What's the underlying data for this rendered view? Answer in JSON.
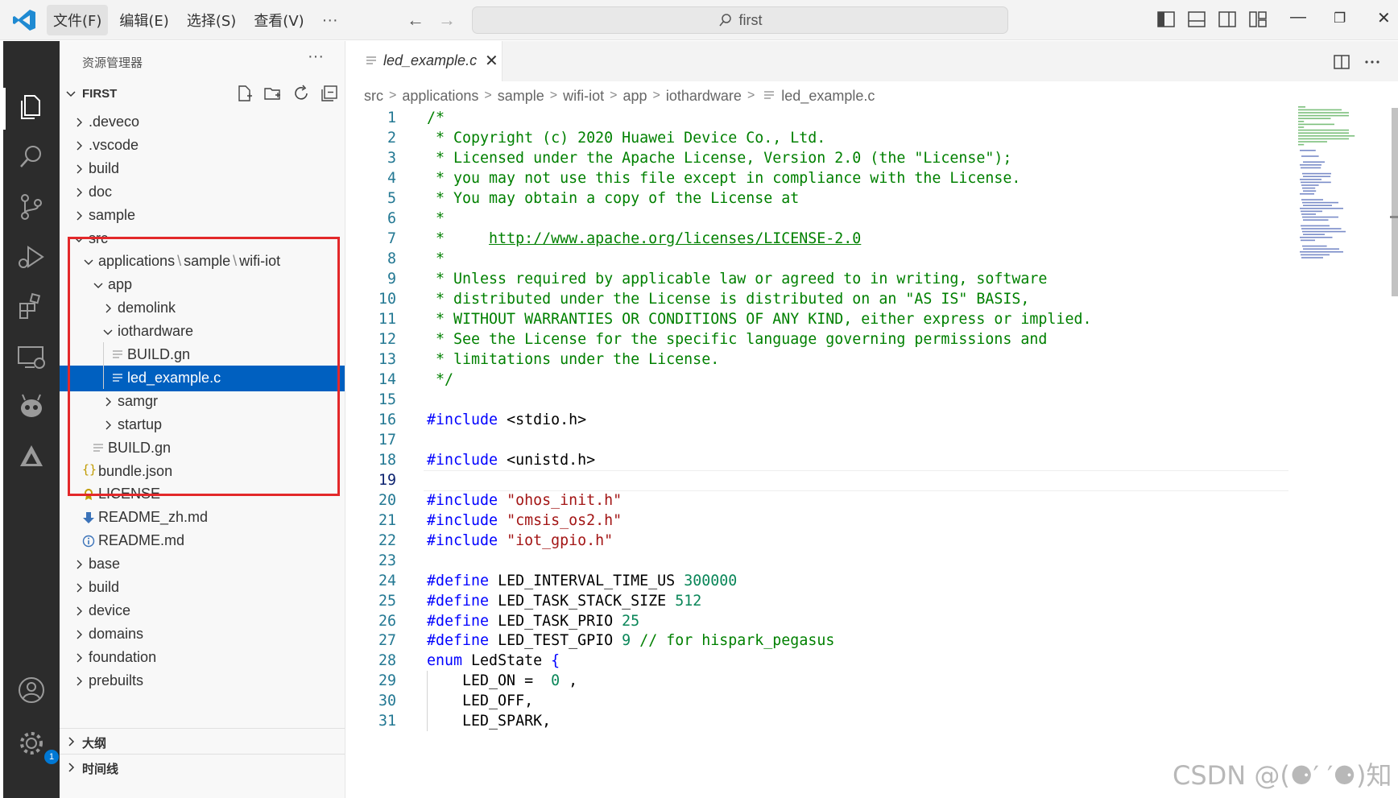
{
  "menu": {
    "items": [
      "文件(F)",
      "编辑(E)",
      "选择(S)",
      "查看(V)"
    ],
    "more": "···"
  },
  "command_center": {
    "text": "first"
  },
  "sidebar": {
    "title": "资源管理器",
    "more": "···",
    "section": "FIRST",
    "tree": [
      {
        "label": ".deveco",
        "kind": "folder"
      },
      {
        "label": ".vscode",
        "kind": "folder"
      },
      {
        "label": "build",
        "kind": "folder"
      },
      {
        "label": "doc",
        "kind": "folder"
      },
      {
        "label": "sample",
        "kind": "folder"
      },
      {
        "label": "src",
        "kind": "folder-open"
      },
      {
        "label_parts": [
          "applications",
          "sample",
          "wifi-iot"
        ],
        "kind": "folder-open"
      },
      {
        "label": "app",
        "kind": "folder-open"
      },
      {
        "label": "demolink",
        "kind": "folder"
      },
      {
        "label": "iothardware",
        "kind": "folder-open"
      },
      {
        "label": "BUILD.gn",
        "kind": "file"
      },
      {
        "label": "led_example.c",
        "kind": "file",
        "selected": true
      },
      {
        "label": "samgr",
        "kind": "folder"
      },
      {
        "label": "startup",
        "kind": "folder"
      },
      {
        "label": "BUILD.gn",
        "kind": "file"
      },
      {
        "label": "bundle.json",
        "kind": "json"
      },
      {
        "label": "LICENSE",
        "kind": "license"
      },
      {
        "label": "README_zh.md",
        "kind": "readme-download"
      },
      {
        "label": "README.md",
        "kind": "info"
      },
      {
        "label": "base",
        "kind": "folder"
      },
      {
        "label": "build",
        "kind": "folder"
      },
      {
        "label": "device",
        "kind": "folder"
      },
      {
        "label": "domains",
        "kind": "folder"
      },
      {
        "label": "foundation",
        "kind": "folder"
      },
      {
        "label": "prebuilts",
        "kind": "folder"
      }
    ],
    "outline": "大纲",
    "timeline": "时间线"
  },
  "activity_badge": "1",
  "editor": {
    "tab": "led_example.c",
    "breadcrumb": [
      "src",
      "applications",
      "sample",
      "wifi-iot",
      "app",
      "iothardware",
      "led_example.c"
    ],
    "lines": [
      "1",
      "2",
      "3",
      "4",
      "5",
      "6",
      "7",
      "8",
      "9",
      "10",
      "11",
      "12",
      "13",
      "14",
      "15",
      "16",
      "17",
      "18",
      "19",
      "20",
      "21",
      "22",
      "23",
      "24",
      "25",
      "26",
      "27",
      "28",
      "29",
      "30",
      "31"
    ],
    "current_line": 19,
    "code": [
      [
        [
          "c-com",
          "/*"
        ]
      ],
      [
        [
          "c-com",
          " * Copyright (c) 2020 Huawei Device Co., Ltd."
        ]
      ],
      [
        [
          "c-com",
          " * Licensed under the Apache License, Version 2.0 (the \"License\");"
        ]
      ],
      [
        [
          "c-com",
          " * you may not use this file except in compliance with the License."
        ]
      ],
      [
        [
          "c-com",
          " * You may obtain a copy of the License at"
        ]
      ],
      [
        [
          "c-com",
          " *"
        ]
      ],
      [
        [
          "c-com",
          " *     "
        ],
        [
          "c-link",
          "http://www.apache.org/licenses/LICENSE-2.0"
        ]
      ],
      [
        [
          "c-com",
          " *"
        ]
      ],
      [
        [
          "c-com",
          " * Unless required by applicable law or agreed to in writing, software"
        ]
      ],
      [
        [
          "c-com",
          " * distributed under the License is distributed on an \"AS IS\" BASIS,"
        ]
      ],
      [
        [
          "c-com",
          " * WITHOUT WARRANTIES OR CONDITIONS OF ANY KIND, either express or implied."
        ]
      ],
      [
        [
          "c-com",
          " * See the License for the specific language governing permissions and"
        ]
      ],
      [
        [
          "c-com",
          " * limitations under the License."
        ]
      ],
      [
        [
          "c-com",
          " */"
        ]
      ],
      [],
      [
        [
          "c-kw",
          "#include"
        ],
        [
          "",
          "<stdio.h>"
        ]
      ],
      [],
      [
        [
          "c-kw",
          "#include"
        ],
        [
          "",
          "<unistd.h>"
        ]
      ],
      [],
      [
        [
          "c-kw",
          "#include"
        ],
        [
          "c-str",
          "\"ohos_init.h\""
        ]
      ],
      [
        [
          "c-kw",
          "#include"
        ],
        [
          "c-str",
          "\"cmsis_os2.h\""
        ]
      ],
      [
        [
          "c-kw",
          "#include"
        ],
        [
          "c-str",
          "\"iot_gpio.h\""
        ]
      ],
      [],
      [
        [
          "c-kw",
          "#define"
        ],
        [
          "",
          "LED_INTERVAL_TIME_US"
        ],
        [
          "c-num",
          "300000"
        ]
      ],
      [
        [
          "c-kw",
          "#define"
        ],
        [
          "",
          "LED_TASK_STACK_SIZE"
        ],
        [
          "c-num",
          "512"
        ]
      ],
      [
        [
          "c-kw",
          "#define"
        ],
        [
          "",
          "LED_TASK_PRIO"
        ],
        [
          "c-num",
          "25"
        ]
      ],
      [
        [
          "c-kw",
          "#define"
        ],
        [
          "",
          "LED_TEST_GPIO"
        ],
        [
          "c-num",
          "9"
        ],
        [
          "c-com",
          "// for hispark_pegasus"
        ]
      ],
      [
        [
          "c-kw",
          "enum"
        ],
        [
          "",
          "LedState"
        ],
        [
          "c-kw",
          "{"
        ]
      ],
      [
        [
          "c-ws",
          "    "
        ],
        [
          "",
          "LED_ON = "
        ],
        [
          "c-num",
          "0"
        ],
        [
          "",
          ","
        ]
      ],
      [
        [
          "c-ws",
          "    "
        ],
        [
          "",
          "LED_OFF,"
        ]
      ],
      [
        [
          "c-ws",
          "    "
        ],
        [
          "",
          "LED_SPARK,"
        ]
      ]
    ]
  },
  "watermark": "CSDN @(⚈′ ′⚈)知"
}
